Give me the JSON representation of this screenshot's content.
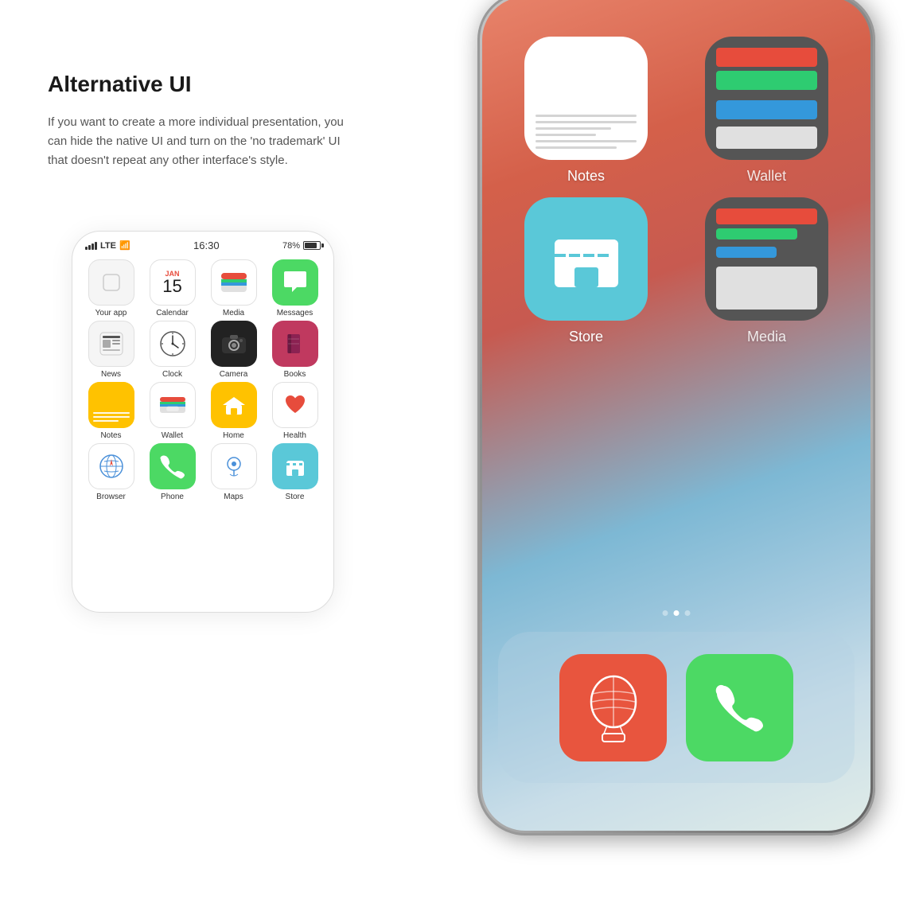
{
  "page": {
    "title": "Alternative UI",
    "description": "If you want to create a more individual presentation, you can hide the native UI and turn on the 'no trademark' UI that doesn't repeat any other interface's style."
  },
  "small_phone": {
    "status": {
      "signal": "LTE",
      "wifi": "wifi",
      "time": "16:30",
      "battery_percent": "78%"
    },
    "apps": [
      {
        "id": "your-app",
        "label": "Your app",
        "icon_type": "blank"
      },
      {
        "id": "calendar",
        "label": "Calendar",
        "icon_type": "calendar",
        "day": "15"
      },
      {
        "id": "media",
        "label": "Media",
        "icon_type": "media"
      },
      {
        "id": "messages",
        "label": "Messages",
        "icon_type": "messages"
      },
      {
        "id": "news",
        "label": "News",
        "icon_type": "news"
      },
      {
        "id": "clock",
        "label": "Clock",
        "icon_type": "clock"
      },
      {
        "id": "camera",
        "label": "Camera",
        "icon_type": "camera"
      },
      {
        "id": "books",
        "label": "Books",
        "icon_type": "books"
      },
      {
        "id": "notes",
        "label": "Notes",
        "icon_type": "notes"
      },
      {
        "id": "wallet",
        "label": "Wallet",
        "icon_type": "wallet"
      },
      {
        "id": "home",
        "label": "Home",
        "icon_type": "home"
      },
      {
        "id": "health",
        "label": "Health",
        "icon_type": "health"
      },
      {
        "id": "browser",
        "label": "Browser",
        "icon_type": "browser"
      },
      {
        "id": "phone",
        "label": "Phone",
        "icon_type": "phone"
      },
      {
        "id": "maps",
        "label": "Maps",
        "icon_type": "maps"
      },
      {
        "id": "store",
        "label": "Store",
        "icon_type": "store"
      }
    ]
  },
  "big_phone": {
    "apps": [
      {
        "id": "notes",
        "label": "Notes"
      },
      {
        "id": "wallet",
        "label": "Wallet"
      },
      {
        "id": "store",
        "label": "Store"
      },
      {
        "id": "media",
        "label": "Media"
      }
    ],
    "dock": [
      {
        "id": "hot-air-balloon",
        "label": ""
      },
      {
        "id": "phone",
        "label": ""
      }
    ]
  }
}
